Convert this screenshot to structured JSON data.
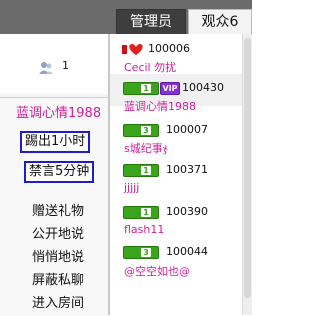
{
  "tabs": {
    "admin_label": "管理员",
    "audience_label": "观众6"
  },
  "left_panel": {
    "online_count": "1",
    "selected_user_name": "蓝调心情1988",
    "actions": {
      "kick_label": "踢出1小时",
      "mute_label": "禁言5分钟"
    },
    "menu": [
      "赠送礼物",
      "公开地说",
      "悄悄地说",
      "屏蔽私聊",
      "进入房间"
    ]
  },
  "users": [
    {
      "id": "100006",
      "nick": "Cecil 勿扰",
      "badge": "heart"
    },
    {
      "id": "100430",
      "nick": "蓝调心情1988",
      "badge": "level1-vip",
      "badge_text": "1",
      "vip_text": "VIP"
    },
    {
      "id": "100007",
      "nick": "s城纪事ჯ",
      "badge": "level3",
      "badge_text": "3"
    },
    {
      "id": "100371",
      "nick": "jjjjj",
      "badge": "level1",
      "badge_text": "1"
    },
    {
      "id": "100390",
      "nick": "flash11",
      "badge": "level1",
      "badge_text": "1"
    },
    {
      "id": "100044",
      "nick": "@空空如也@",
      "badge": "level3",
      "badge_text": "3"
    }
  ],
  "colors": {
    "nick_pink": "#cc1f99",
    "action_border": "#1d1dcc",
    "badge_green": "#3aa41a",
    "vip_purple": "#8a2be2"
  }
}
